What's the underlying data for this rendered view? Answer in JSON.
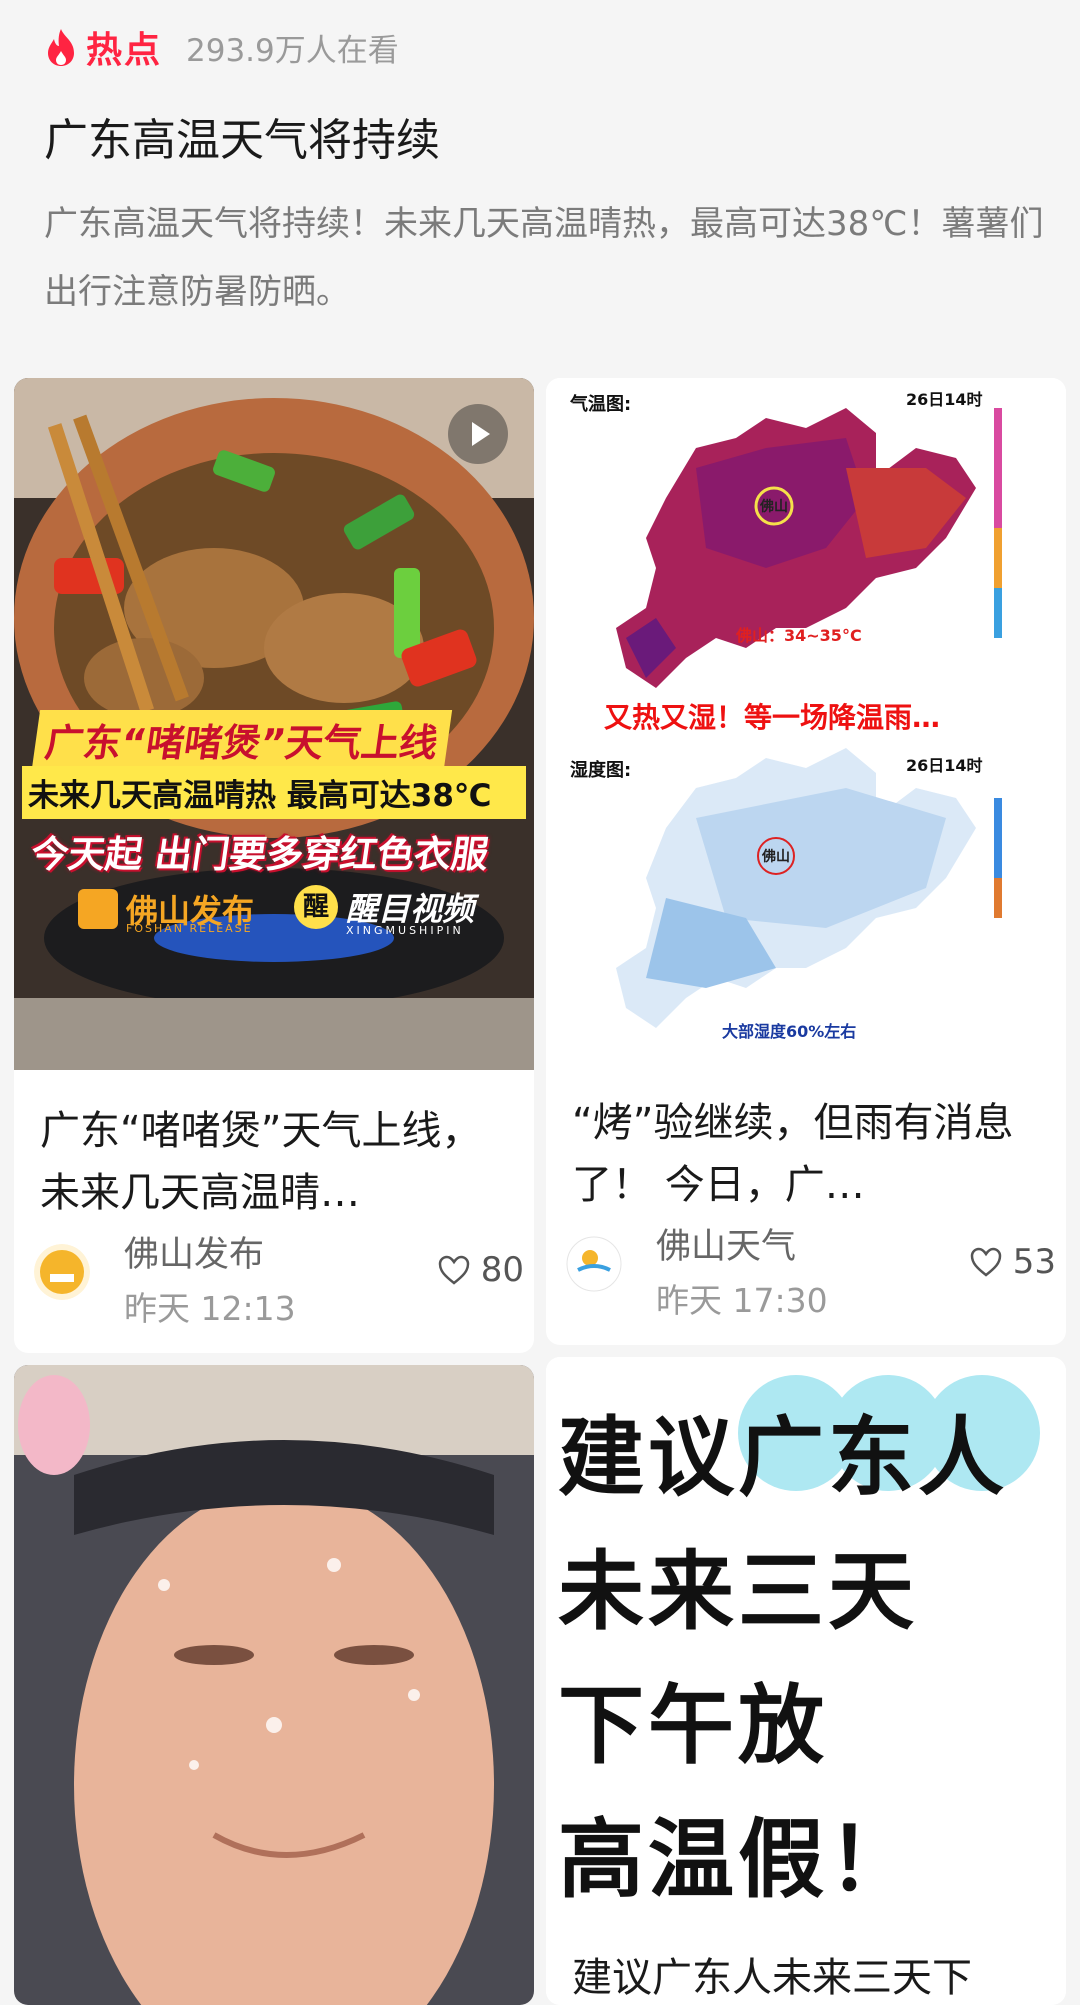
{
  "header": {
    "hot_label": "热点",
    "viewer_count": "293.9万人在看"
  },
  "topic": {
    "title": "广东高温天气将持续",
    "description": "广东高温天气将持续！未来几天高温晴热，最高可达38℃！薯薯们出行注意防暑防晒。"
  },
  "colors": {
    "brand_red": "#ff2442",
    "page_bg": "#f5f5f5"
  },
  "cards": [
    {
      "cover_captions": {
        "line1": "广东“啫啫煲”天气上线",
        "line2": "未来几天高温晴热 最高可达38℃",
        "line3": "今天起 出门要多穿红色衣服",
        "logo1": "佛山发布",
        "logo1_sub": "FOSHAN RELEASE",
        "logo2_mark": "醒",
        "logo2": "醒目视频",
        "logo2_sub": "XINGMUSHIPIN"
      },
      "has_video": true,
      "title": "广东“啫啫煲”天气上线，未来几天高温晴…",
      "author": "佛山发布",
      "time": "昨天 12:13",
      "likes": "80"
    },
    {
      "cover_captions": {
        "temp_map_label": "气温图:",
        "temp_map_date": "26日14时",
        "temp_city": "佛山",
        "temp_note": "佛山：34~35°C",
        "banner": "又热又湿！等一场降温雨…",
        "humid_map_label": "湿度图:",
        "humid_map_date": "26日14时",
        "humid_city": "佛山",
        "humid_note": "大部湿度60%左右"
      },
      "title": "“烤”验继续，但雨有消息了！ 今日，广…",
      "author": "佛山天气",
      "time": "昨天 17:30",
      "likes": "53"
    },
    {
      "has_video": false
    },
    {
      "cover_lines": [
        "建议",
        "广东人",
        "未来三天",
        "下午放",
        "高温假！"
      ],
      "subline": "建议广东人未来三天下"
    }
  ]
}
